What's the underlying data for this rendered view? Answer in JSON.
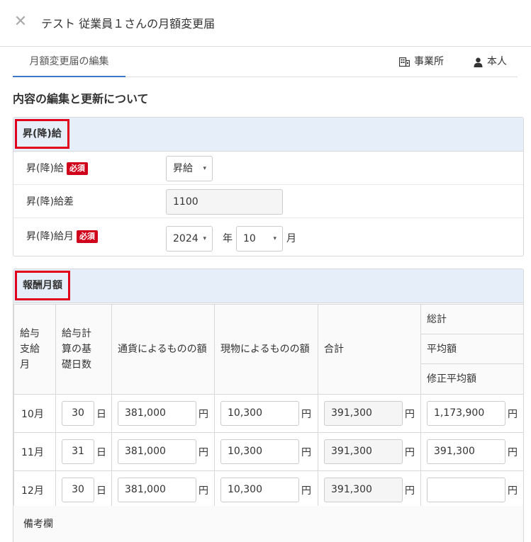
{
  "header": {
    "title": "テスト 従業員１さんの月額変更届",
    "close_icon": "close-icon"
  },
  "tabs": {
    "active": "月額変更届の編集",
    "office": "事業所",
    "person": "本人"
  },
  "section_title": "内容の編集と更新について",
  "raise_panel": {
    "title": "昇(降)給",
    "required": "必須",
    "rows": {
      "raise_label": "昇(降)給",
      "raise_value": "昇給",
      "diff_label": "昇(降)給差",
      "diff_value": "1100",
      "month_label": "昇(降)給月",
      "year_value": "2024",
      "year_unit": "年",
      "month_value": "10",
      "month_unit": "月"
    }
  },
  "pay_panel": {
    "title": "報酬月額",
    "headers": {
      "month": "給与\n支給\n月",
      "days": "給与計\n算の基\n礎日数",
      "currency": "通貨によるものの額",
      "goods": "現物によるものの額",
      "total": "合計",
      "sum": "総計",
      "avg": "平均額",
      "adj_avg": "修正平均額"
    },
    "units": {
      "day": "日",
      "yen": "円"
    },
    "rows": [
      {
        "month": "10月",
        "days": "30",
        "currency": "381,000",
        "goods": "10,300",
        "total": "391,300",
        "summary": "1,173,900"
      },
      {
        "month": "11月",
        "days": "31",
        "currency": "381,000",
        "goods": "10,300",
        "total": "391,300",
        "summary": "391,300"
      },
      {
        "month": "12月",
        "days": "30",
        "currency": "381,000",
        "goods": "10,300",
        "total": "391,300",
        "summary": ""
      }
    ],
    "remarks_label": "備考欄"
  }
}
